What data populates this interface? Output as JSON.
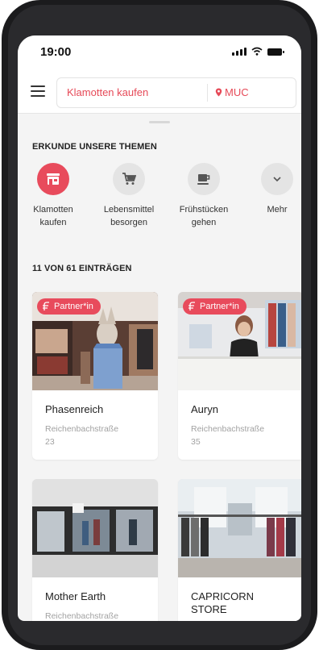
{
  "status": {
    "time": "19:00"
  },
  "search": {
    "query": "Klamotten kaufen",
    "location": "MUC"
  },
  "themes": {
    "title": "ERKUNDE UNSERE THEMEN",
    "items": [
      {
        "line1": "Klamotten",
        "line2": "kaufen",
        "icon": "store-icon",
        "active": true
      },
      {
        "line1": "Lebensmittel",
        "line2": "besorgen",
        "icon": "cart-icon"
      },
      {
        "line1": "Frühstücken",
        "line2": "gehen",
        "icon": "coffee-cup-icon"
      },
      {
        "line1": "Mehr",
        "line2": "",
        "icon": "chevron-down-icon"
      }
    ]
  },
  "results": {
    "count_label": "11 VON 61 EINTRÄGEN",
    "badge_label": "Partner*in",
    "items": [
      {
        "name": "Phasenreich",
        "street": "Reichenbachstraße",
        "number": "23",
        "partner": true
      },
      {
        "name": "Auryn",
        "street": "Reichenbachstraße",
        "number": "35",
        "partner": true
      },
      {
        "name": "Mother Earth",
        "street": "Reichenbachstraße",
        "number": ""
      },
      {
        "name": "CAPRICORN",
        "name2": "STORE",
        "street": "",
        "number": ""
      }
    ]
  },
  "colors": {
    "accent": "#e84b5c",
    "background": "#f4f4f4",
    "secondary_text": "#a2a2a2"
  }
}
